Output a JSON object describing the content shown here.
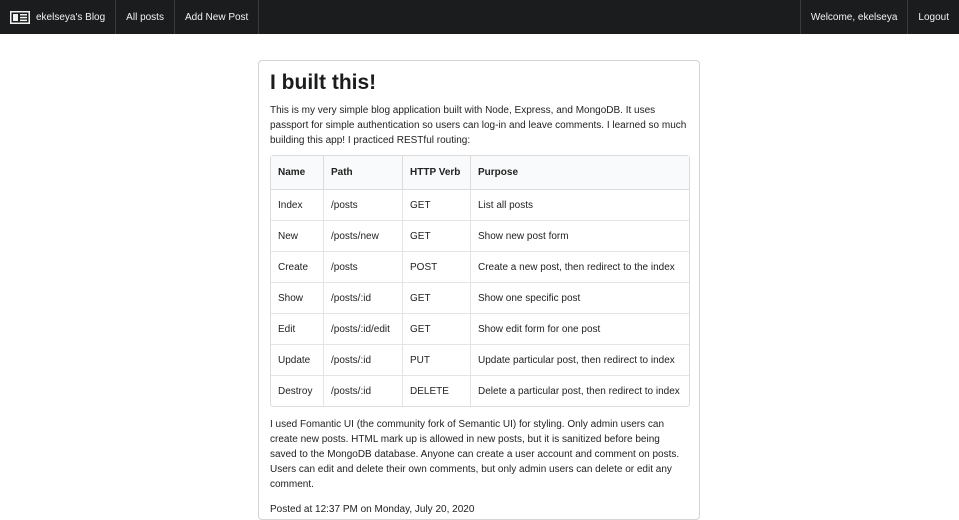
{
  "navbar": {
    "brand_icon": "newspaper-icon",
    "brand": "ekelseya's Blog",
    "all_posts": "All posts",
    "add_new_post": "Add New Post",
    "welcome": "Welcome, ekelseya",
    "logout": "Logout"
  },
  "post": {
    "title": "I built this!",
    "intro": "This is my very simple blog application built with Node, Express, and MongoDB. It uses passport for simple authentication so users can log-in and leave comments. I learned so much building this app! I practiced RESTful routing:",
    "table": {
      "headers": [
        "Name",
        "Path",
        "HTTP Verb",
        "Purpose"
      ],
      "rows": [
        [
          "Index",
          "/posts",
          "GET",
          "List all posts"
        ],
        [
          "New",
          "/posts/new",
          "GET",
          "Show new post form"
        ],
        [
          "Create",
          "/posts",
          "POST",
          "Create a new post, then redirect to the index"
        ],
        [
          "Show",
          "/posts/:id",
          "GET",
          "Show one specific post"
        ],
        [
          "Edit",
          "/posts/:id/edit",
          "GET",
          "Show edit form for one post"
        ],
        [
          "Update",
          "/posts/:id",
          "PUT",
          "Update particular post, then redirect to index"
        ],
        [
          "Destroy",
          "/posts/:id",
          "DELETE",
          "Delete a particular post, then redirect to index"
        ]
      ]
    },
    "outro": "I used Fomantic UI (the community fork of Semantic UI) for styling. Only admin users can create new posts. HTML mark up is allowed in new posts, but it is sanitized before being saved to the MongoDB database. Anyone can create a user account and comment on posts. Users can edit and delete their own comments, but only admin users can delete or edit any comment.",
    "meta": "Posted at 12:37 PM on Monday, July 20, 2020"
  },
  "colors": {
    "navbar_bg": "#1b1c1d",
    "table_header_bg": "#f9fafb"
  }
}
